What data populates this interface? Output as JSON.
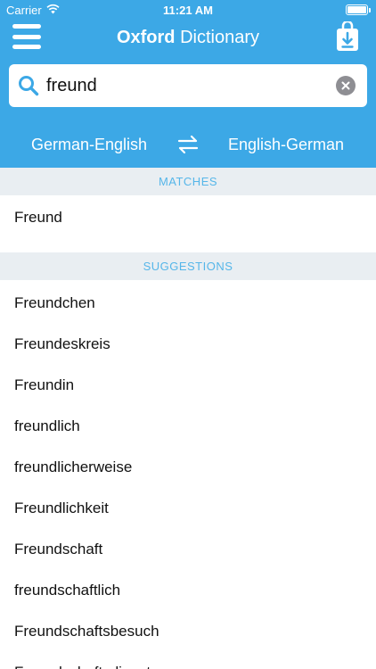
{
  "status_bar": {
    "carrier": "Carrier",
    "time": "11:21 AM"
  },
  "header": {
    "title_brand": "Oxford",
    "title_rest": "Dictionary"
  },
  "search": {
    "value": "freund"
  },
  "languages": {
    "left": "German-English",
    "right": "English-German"
  },
  "sections": {
    "matches_title": "MATCHES",
    "suggestions_title": "SUGGESTIONS"
  },
  "matches": [
    "Freund"
  ],
  "suggestions": [
    "Freundchen",
    "Freundeskreis",
    "Freundin",
    "freundlich",
    "freundlicherweise",
    "Freundlichkeit",
    "Freundschaft",
    "freundschaftlich",
    "Freundschaftsbesuch",
    "Freundschaftsdienst"
  ],
  "colors": {
    "accent": "#3ca8e6",
    "section_background": "#e9eef2",
    "section_text": "#56b6e9"
  },
  "icons": {
    "menu": "hamburger-icon",
    "download": "download-bag-icon",
    "search": "search-icon",
    "clear": "clear-icon",
    "swap": "swap-arrows-icon",
    "wifi": "wifi-icon",
    "battery": "battery-icon"
  }
}
